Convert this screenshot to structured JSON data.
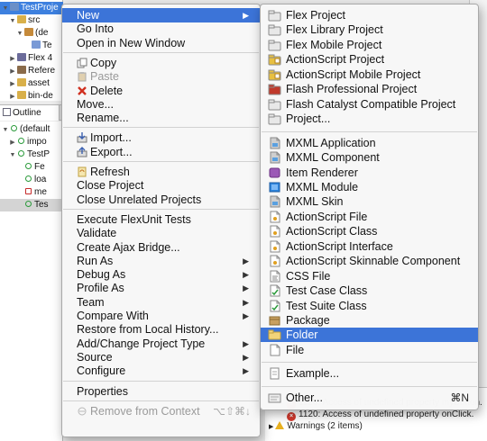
{
  "ide": {
    "project_tree": [
      {
        "text": "TestProje",
        "selected": true,
        "twisty": "▼"
      },
      {
        "text": "src",
        "selected": false,
        "twisty": "▼"
      },
      {
        "text": "(de",
        "selected": false,
        "twisty": "▼"
      },
      {
        "text": "Te",
        "selected": false,
        "twisty": ""
      },
      {
        "text": "Flex 4",
        "selected": false,
        "twisty": "▶"
      },
      {
        "text": "Refere",
        "selected": false,
        "twisty": "▶"
      },
      {
        "text": "asset",
        "selected": false,
        "twisty": "▶"
      },
      {
        "text": "bin-de",
        "selected": false,
        "twisty": "▶"
      }
    ],
    "outline_tab_label": "Outline",
    "outline_rows": [
      {
        "text": "(default",
        "twisty": "▼"
      },
      {
        "text": "impo",
        "twisty": "▶"
      },
      {
        "text": "TestP",
        "twisty": "▼"
      },
      {
        "text": "Fe",
        "twisty": ""
      },
      {
        "text": "loa",
        "twisty": ""
      },
      {
        "text": "me",
        "twisty": ""
      },
      {
        "text": "Tes",
        "twisty": ""
      }
    ],
    "problems": [
      {
        "text": "1120: Access of undefined property myButton.",
        "kind": "error"
      },
      {
        "text": "1120: Access of undefined property onClick.",
        "kind": "error"
      },
      {
        "text": "Warnings (2 items)",
        "kind": "warning",
        "twisty": "▶"
      }
    ]
  },
  "context_menu": {
    "items": [
      {
        "label": "New",
        "submenu": true,
        "highlighted": true
      },
      {
        "label": "Go Into"
      },
      {
        "label": "Open in New Window"
      },
      {
        "sep": true
      },
      {
        "label": "Copy",
        "icon": "copy-icon"
      },
      {
        "label": "Paste",
        "icon": "paste-icon",
        "disabled": true
      },
      {
        "label": "Delete",
        "icon": "delete-icon"
      },
      {
        "label": "Move..."
      },
      {
        "label": "Rename..."
      },
      {
        "sep": true
      },
      {
        "label": "Import...",
        "icon": "import-icon"
      },
      {
        "label": "Export...",
        "icon": "export-icon"
      },
      {
        "sep": true
      },
      {
        "label": "Refresh",
        "icon": "refresh-icon"
      },
      {
        "label": "Close Project"
      },
      {
        "label": "Close Unrelated Projects"
      },
      {
        "sep": true
      },
      {
        "label": "Execute FlexUnit Tests"
      },
      {
        "label": "Validate"
      },
      {
        "label": "Create Ajax Bridge..."
      },
      {
        "label": "Run As",
        "submenu": true
      },
      {
        "label": "Debug As",
        "submenu": true
      },
      {
        "label": "Profile As",
        "submenu": true
      },
      {
        "label": "Team",
        "submenu": true
      },
      {
        "label": "Compare With",
        "submenu": true
      },
      {
        "label": "Restore from Local History..."
      },
      {
        "label": "Add/Change Project Type",
        "submenu": true
      },
      {
        "label": "Source",
        "submenu": true
      },
      {
        "label": "Configure",
        "submenu": true
      },
      {
        "sep": true
      },
      {
        "label": "Properties"
      },
      {
        "sep": true
      },
      {
        "label": "Remove from Context",
        "icon": "remove-context-icon",
        "disabled": true,
        "shortcut": "⌥⇧⌘↓"
      }
    ]
  },
  "new_submenu": {
    "items": [
      {
        "label": "Flex Project",
        "icon": "flex-project-icon",
        "color": "#e8e8e8"
      },
      {
        "label": "Flex Library Project",
        "icon": "flex-library-project-icon",
        "color": "#e8e8e8"
      },
      {
        "label": "Flex Mobile Project",
        "icon": "flex-mobile-project-icon",
        "color": "#e8e8e8"
      },
      {
        "label": "ActionScript Project",
        "icon": "actionscript-project-icon",
        "color": "#e8c040"
      },
      {
        "label": "ActionScript Mobile Project",
        "icon": "actionscript-mobile-project-icon",
        "color": "#e8c040"
      },
      {
        "label": "Flash Professional Project",
        "icon": "flash-professional-project-icon",
        "color": "#c0392b"
      },
      {
        "label": "Flash Catalyst Compatible Project",
        "icon": "flash-catalyst-project-icon",
        "color": "#e8e8e8"
      },
      {
        "label": "Project...",
        "icon": "project-icon",
        "color": "#e8e8e8"
      },
      {
        "sep": true
      },
      {
        "label": "MXML Application",
        "icon": "mxml-application-icon",
        "color": "#cfcfcf"
      },
      {
        "label": "MXML Component",
        "icon": "mxml-component-icon",
        "color": "#cfcfcf"
      },
      {
        "label": "Item Renderer",
        "icon": "item-renderer-icon",
        "color": "#9b59b6"
      },
      {
        "label": "MXML Module",
        "icon": "mxml-module-icon",
        "color": "#2e86de"
      },
      {
        "label": "MXML Skin",
        "icon": "mxml-skin-icon",
        "color": "#cfcfcf"
      },
      {
        "label": "ActionScript File",
        "icon": "actionscript-file-icon",
        "color": "#ffffff"
      },
      {
        "label": "ActionScript Class",
        "icon": "actionscript-class-icon",
        "color": "#ffffff"
      },
      {
        "label": "ActionScript Interface",
        "icon": "actionscript-interface-icon",
        "color": "#ffffff"
      },
      {
        "label": "ActionScript Skinnable Component",
        "icon": "actionscript-skinnable-component-icon",
        "color": "#ffffff"
      },
      {
        "label": "CSS File",
        "icon": "css-file-icon",
        "color": "#ffffff"
      },
      {
        "label": "Test Case Class",
        "icon": "test-case-class-icon",
        "color": "#ffffff"
      },
      {
        "label": "Test Suite Class",
        "icon": "test-suite-class-icon",
        "color": "#ffffff"
      },
      {
        "label": "Package",
        "icon": "package-icon",
        "color": "#c8a060"
      },
      {
        "label": "Folder",
        "icon": "folder-icon",
        "color": "#e8c870",
        "highlighted": true
      },
      {
        "label": "File",
        "icon": "file-icon",
        "color": "#ffffff"
      },
      {
        "sep": true
      },
      {
        "label": "Example...",
        "icon": "example-icon",
        "color": "#ffffff"
      },
      {
        "sep": true
      },
      {
        "label": "Other...",
        "icon": "other-icon",
        "color": "#ffffff",
        "shortcut": "⌘N"
      }
    ]
  },
  "colors": {
    "highlight": "#3c74d8",
    "tree_selection": "#3d80df",
    "error": "#d23a2e",
    "warning": "#e8b020"
  }
}
